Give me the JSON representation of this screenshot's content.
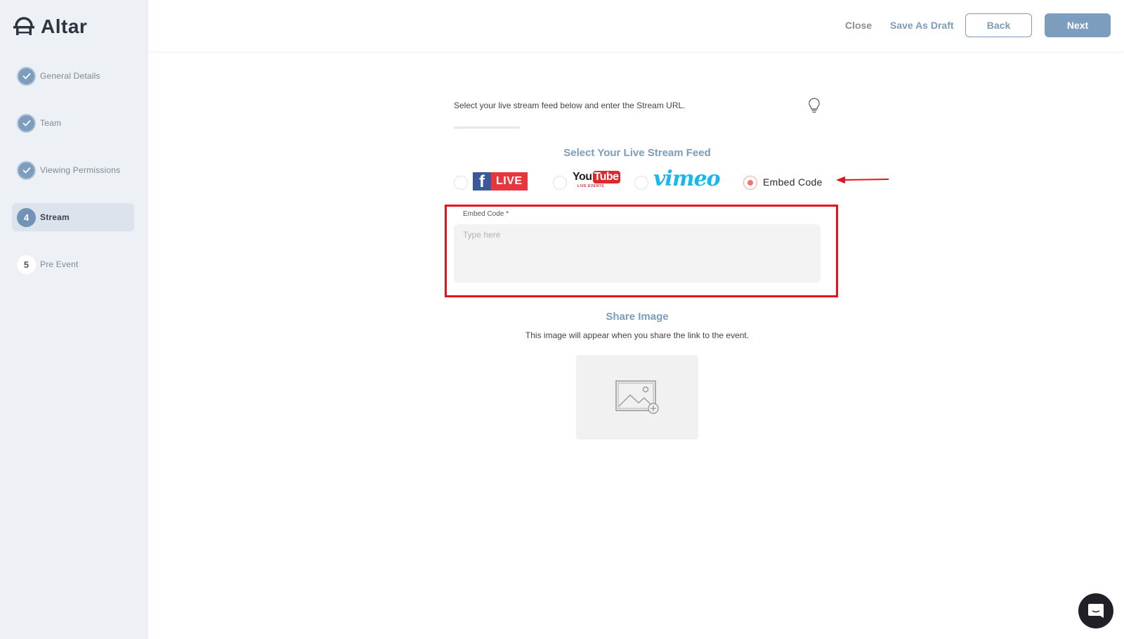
{
  "app": {
    "name": "Altar"
  },
  "sidebar": {
    "steps": [
      {
        "number": "",
        "label": "General Details",
        "state": "done"
      },
      {
        "number": "",
        "label": "Team",
        "state": "done"
      },
      {
        "number": "",
        "label": "Viewing Permissions",
        "state": "done"
      },
      {
        "number": "4",
        "label": "Stream",
        "state": "current"
      },
      {
        "number": "5",
        "label": "Pre Event",
        "state": "pending"
      }
    ]
  },
  "header": {
    "close_label": "Close",
    "draft_label": "Save As Draft",
    "back_label": "Back",
    "next_label": "Next"
  },
  "main": {
    "instruction": "Select your live stream feed below and enter the Stream URL.",
    "feed_title": "Select Your Live Stream Feed",
    "feeds": {
      "facebook": {
        "icon": "facebook-f-icon",
        "badge": "LIVE"
      },
      "youtube": {
        "part1": "You",
        "part2": "Tube",
        "sub": "LIVE EVENTS"
      },
      "vimeo": {
        "wordmark": "vimeo"
      },
      "embed": {
        "label": "Embed Code",
        "selected": true
      }
    },
    "embed_field": {
      "label": "Embed Code *",
      "placeholder": "Type here",
      "value": ""
    },
    "share": {
      "title": "Share Image",
      "subtitle": "This image will appear when you share the link to the event."
    }
  },
  "colors": {
    "accent": "#7b9cbb",
    "highlight_box": "#e3141c",
    "radio_selected": "#f27466",
    "sidebar_bg": "#edf0f4"
  }
}
